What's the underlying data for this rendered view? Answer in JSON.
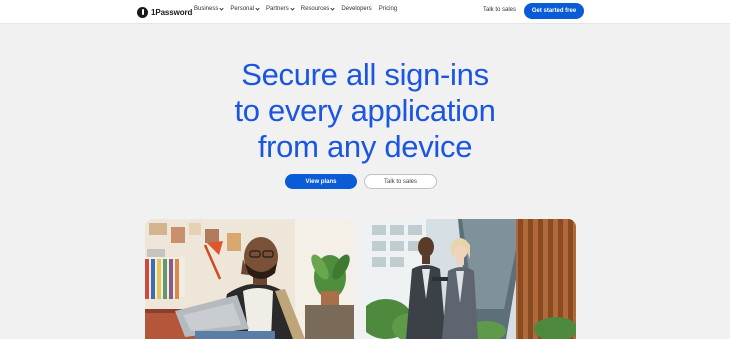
{
  "brand": {
    "name": "1Password"
  },
  "nav": {
    "items": [
      {
        "label": "Business",
        "dropdown": true
      },
      {
        "label": "Personal",
        "dropdown": true
      },
      {
        "label": "Partners",
        "dropdown": true
      },
      {
        "label": "Resources",
        "dropdown": true
      },
      {
        "label": "Developers",
        "dropdown": false
      },
      {
        "label": "Pricing",
        "dropdown": false
      }
    ],
    "talk_to_sales": "Talk to sales",
    "cta": "Get started free"
  },
  "hero": {
    "lines": [
      "Secure all sign-ins",
      "to every application",
      "from any device"
    ]
  },
  "buttons": {
    "primary": "View plans",
    "secondary": "Talk to sales"
  },
  "colors": {
    "accent": "#0a5bd6",
    "headline": "#1a56e0",
    "background": "#f1f1f2"
  }
}
